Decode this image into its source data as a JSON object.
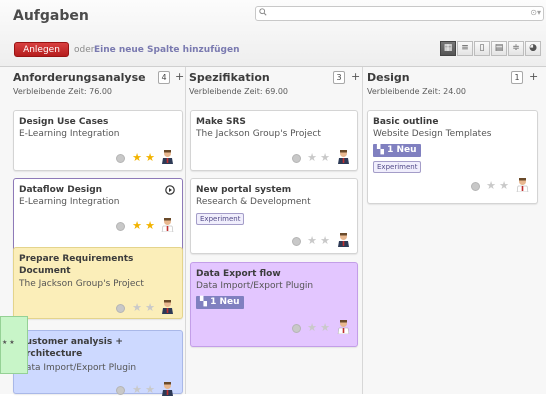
{
  "header": {
    "title": "Aufgaben",
    "create_label": "Anlegen",
    "or_label": "oder",
    "add_column_label": "Eine neue Spalte hinzufügen",
    "view_buttons": [
      "kanban",
      "list",
      "form",
      "calendar",
      "gantt",
      "graph"
    ]
  },
  "columns": [
    {
      "name": "Anforderungsanalyse",
      "count": "4",
      "remaining": "Verbleibende Zeit: 76.00",
      "cards": [
        {
          "title": "Design Use Cases",
          "project": "E-Learning Integration",
          "stars": 2,
          "color": "white"
        },
        {
          "title": "Dataflow Design",
          "project": "E-Learning Integration",
          "stars": 2,
          "color": "white"
        },
        {
          "title": "Prepare Requirements Document",
          "project": "The Jackson Group's Project",
          "stars": 0,
          "color": "yellow"
        },
        {
          "title": "Customer analysis + Architecture",
          "project": "Data Import/Export Plugin",
          "stars": 0,
          "color": "blue"
        }
      ]
    },
    {
      "name": "Spezifikation",
      "count": "3",
      "remaining": "Verbleibende Zeit: 69.00",
      "cards": [
        {
          "title": "Make SRS",
          "project": "The Jackson Group's Project",
          "stars": 0,
          "color": "white"
        },
        {
          "title": "New portal system",
          "project": "Research & Development",
          "tag": "Experiment",
          "stars": 0,
          "color": "white"
        },
        {
          "title": "Data Export flow",
          "project": "Data Import/Export Plugin",
          "new_badge": "1 Neu",
          "stars": 0,
          "color": "purple"
        }
      ]
    },
    {
      "name": "Design",
      "count": "1",
      "remaining": "Verbleibende Zeit: 24.00",
      "cards": [
        {
          "title": "Basic outline",
          "project": "Website Design Templates",
          "new_badge": "1 Neu",
          "tag": "Experiment",
          "stars": 0,
          "color": "white"
        }
      ]
    }
  ],
  "colors": {
    "create_button": "#c42b2b",
    "card_yellow": "#fbeeb9",
    "card_blue": "#cdd9ff",
    "card_purple": "#e3c6ff",
    "new_badge": "#8080c0",
    "drag_ghost": "#c8f5c8"
  }
}
